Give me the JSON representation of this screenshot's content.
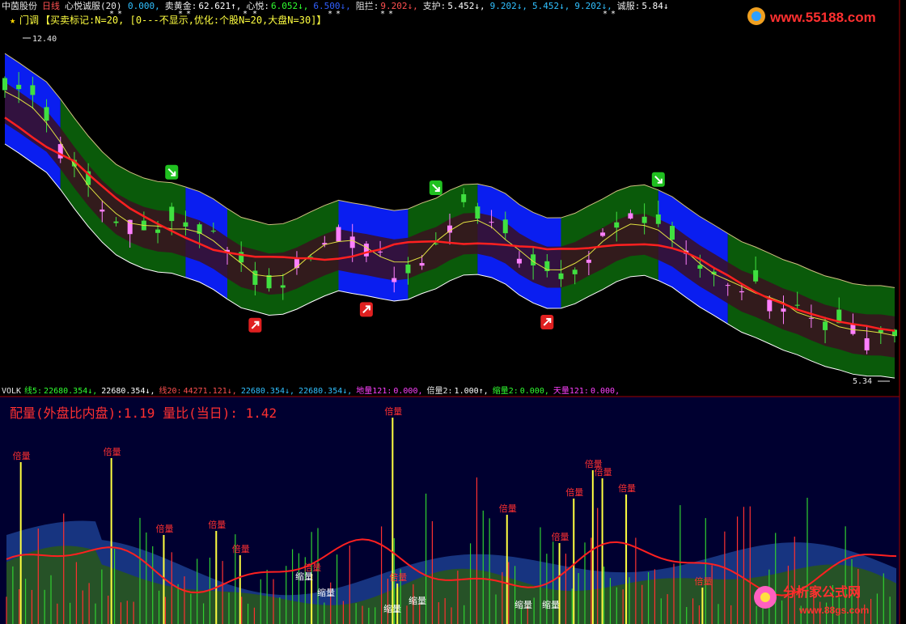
{
  "header": {
    "stock_name": "中茵股份",
    "period": "日线",
    "indicator": "心悦诚服(20)",
    "params": [
      {
        "label": "",
        "value": "0.000,",
        "color": "#30c0ff"
      },
      {
        "label": "卖黄金:",
        "value": "62.621↑,",
        "color": "#ffffff"
      },
      {
        "label": "心悦:",
        "value": "6.052↓,",
        "color": "#30ff30"
      },
      {
        "label": "",
        "value": "6.500↓,",
        "color": "#3060ff"
      },
      {
        "label": "阻拦:",
        "value": "9.202↓,",
        "color": "#ff5050"
      },
      {
        "label": "支护:",
        "value": "5.452↓,",
        "color": "#ffffff"
      },
      {
        "label": "",
        "value": "9.202↓,",
        "color": "#30c0ff"
      },
      {
        "label": "",
        "value": "5.452↓,",
        "color": "#30c0ff"
      },
      {
        "label": "",
        "value": "9.202↓,",
        "color": "#30c0ff"
      },
      {
        "label": "诚服:",
        "value": "5.84↓",
        "color": "#ffffff"
      }
    ],
    "subtitle": "买卖标记:N=20, [0---不显示,优化:个股N=20,大盘N=30]",
    "subtitle_prefix": "门调"
  },
  "watermark_top": "www.55188.com",
  "watermark_bottom": {
    "line1": "分析家公式网",
    "line2": "www.88gs.com"
  },
  "chart_data": [
    {
      "type": "candlestick",
      "title": "心悦诚服(20)",
      "high_label": "12.40",
      "low_label": "5.34",
      "ylim": [
        4.5,
        13.0
      ],
      "markers": {
        "buy_bars": [
          18,
          26,
          39
        ],
        "sell_bars": [
          12,
          31,
          47
        ]
      },
      "ohlc_approx": [
        {
          "bar": 1,
          "close": 11.8
        },
        {
          "bar": 2,
          "close": 11.2
        },
        {
          "bar": 8,
          "close": 8.3
        },
        {
          "bar": 15,
          "close": 8.2
        },
        {
          "bar": 19,
          "close": 6.5
        },
        {
          "bar": 24,
          "close": 8.4
        },
        {
          "bar": 29,
          "close": 6.9
        },
        {
          "bar": 33,
          "close": 8.6
        },
        {
          "bar": 40,
          "close": 7.0
        },
        {
          "bar": 45,
          "close": 8.6
        },
        {
          "bar": 50,
          "close": 7.3
        },
        {
          "bar": 56,
          "close": 6.4
        },
        {
          "bar": 62,
          "close": 5.5
        }
      ]
    },
    {
      "type": "bar",
      "title": "VOLK",
      "legend": [
        {
          "label": "线5:",
          "value": "22680.354↓,",
          "color": "#30ff30"
        },
        {
          "label": "",
          "value": "22680.354↓,",
          "color": "#ffffff"
        },
        {
          "label": "线20:",
          "value": "44271.121↓,",
          "color": "#ff5050"
        },
        {
          "label": "",
          "value": "22680.354↓,",
          "color": "#30c0ff"
        },
        {
          "label": "",
          "value": "22680.354↓,",
          "color": "#30c0ff"
        },
        {
          "label": "地量121:",
          "value": "0.000,",
          "color": "#ff40ff"
        },
        {
          "label": "倍量2:",
          "value": "1.000↑,",
          "color": "#ffffff"
        },
        {
          "label": "缩量2:",
          "value": "0.000,",
          "color": "#30ff30"
        },
        {
          "label": "天量121:",
          "value": "0.000,",
          "color": "#ff40ff"
        }
      ],
      "info_line": "配量(外盘比内盘):1.19   量比(当日): 1.42",
      "labels": {
        "double": "倍量",
        "shrink": "缩量"
      }
    }
  ],
  "colors": {
    "blue_zone": "#0a1ef0",
    "green_zone": "#0a5a0a",
    "maroon_zone": "#3a1020",
    "ma_red": "#ff2020",
    "ma_yellow": "#e0e040",
    "vol_bg": "#000030",
    "frame": "#a00000"
  }
}
